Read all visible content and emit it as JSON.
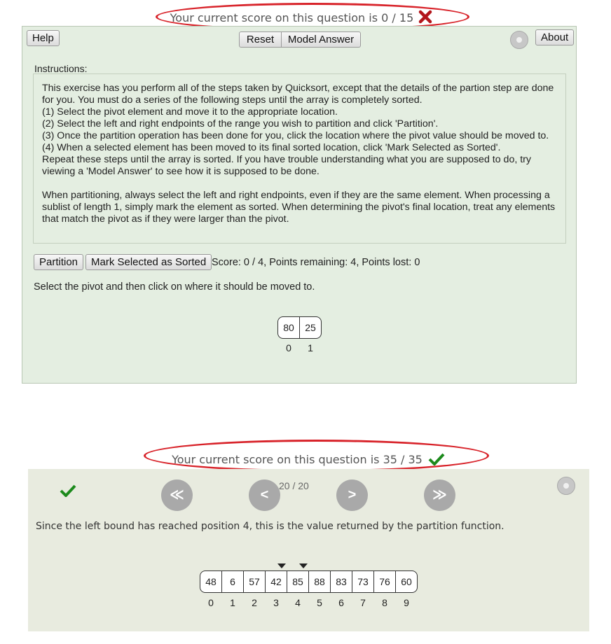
{
  "top": {
    "score_text": "Your current score on this question is 0 / 15",
    "status_icon": "cross-icon",
    "toolbar": {
      "help": "Help",
      "reset": "Reset",
      "model_answer": "Model Answer",
      "about": "About"
    },
    "instructions_label": "Instructions:",
    "instructions": {
      "p1": "This exercise has you perform all of the steps taken by Quicksort, except that the details of the partion step are done for you. You must do a series of the following steps until the array is completely sorted.",
      "s1": "(1) Select the pivot element and move it to the appropriate location.",
      "s2": "(2) Select the left and right endpoints of the range you wish to partition and click 'Partition'.",
      "s3": "(3) Once the partition operation has been done for you, click the location where the pivot value should be moved to.",
      "s4": "(4) When a selected element has been moved to its final sorted location, click 'Mark Selected as Sorted'.",
      "p2": "Repeat these steps until the array is sorted. If you have trouble understanding what you are supposed to do, try viewing a 'Model Answer' to see how it is supposed to be done.",
      "p3": "When partitioning, always select the left and right endpoints, even if they are the same element. When processing a sublist of length 1, simply mark the element as sorted. When determining the pivot's final location, treat any elements that match the pivot as if they were larger than the pivot."
    },
    "partition_button": "Partition",
    "mark_sorted_button": "Mark Selected as Sorted",
    "score_status": "Score: 0 / 4, Points remaining: 4, Points lost: 0",
    "message": "Select the pivot and then click on where it should be moved to.",
    "array": [
      "80",
      "25"
    ],
    "indices": [
      "0",
      "1"
    ]
  },
  "bottom": {
    "score_text": "Your current score on this question is 35 / 35",
    "status_icon": "check-icon",
    "step_counter": "20 / 20",
    "nav": {
      "first": "≪",
      "prev": "<",
      "next": ">",
      "last": "≫"
    },
    "message": "Since the left bound has reached position 4, this is the value returned by the partition function.",
    "array": [
      "48",
      "6",
      "57",
      "42",
      "85",
      "88",
      "83",
      "73",
      "76",
      "60"
    ],
    "indices": [
      "0",
      "1",
      "2",
      "3",
      "4",
      "5",
      "6",
      "7",
      "8",
      "9"
    ],
    "markers_at": [
      3,
      4
    ]
  },
  "colors": {
    "highlight_ellipse": "#d8232a",
    "cross": "#b3151b",
    "check": "#1c8a1c",
    "panel_top": "#e4eee1",
    "panel_bottom": "#e8ebdf"
  }
}
